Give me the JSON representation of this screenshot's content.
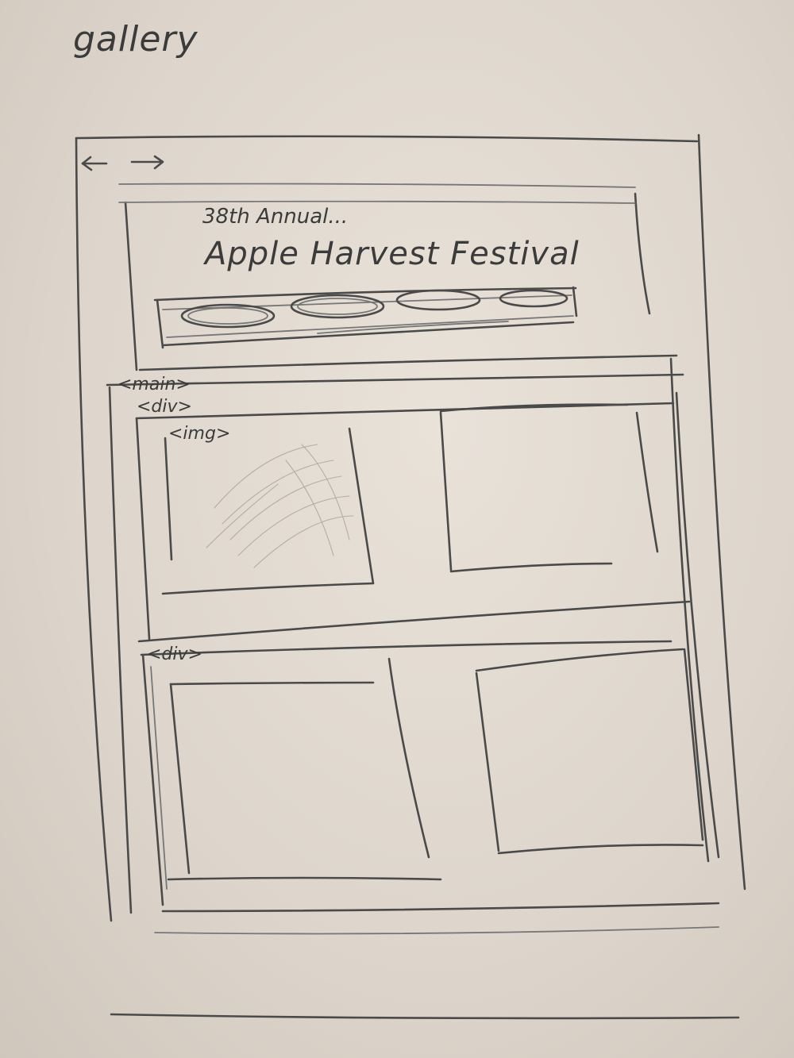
{
  "page_label": "gallery",
  "nav": {
    "back_icon": "arrow-left-icon",
    "forward_icon": "arrow-right-icon"
  },
  "header": {
    "subtitle": "38th Annual...",
    "title": "Apple Harvest Festival",
    "nav_pill_count": 4
  },
  "structure_tags": {
    "main": "<main>",
    "div_first": "<div>",
    "img": "<img>",
    "div_second": "<div>"
  },
  "gallery": {
    "images_per_row": 2,
    "rows": 2
  }
}
